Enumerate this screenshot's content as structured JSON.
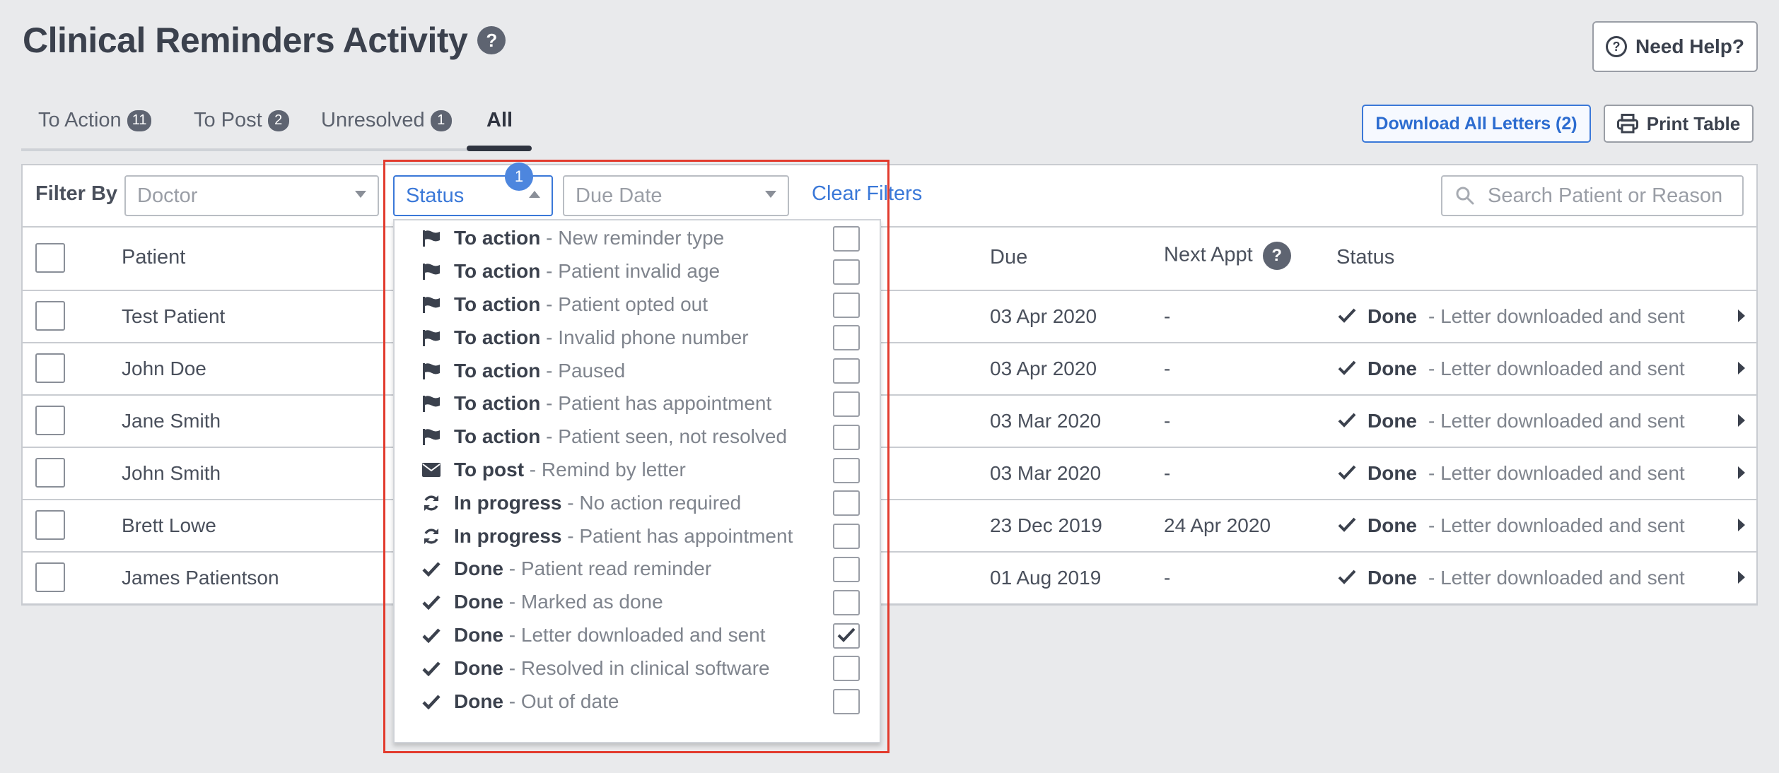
{
  "page": {
    "title": "Clinical Reminders Activity",
    "help_glyph": "?"
  },
  "need_help": {
    "label": "Need Help?"
  },
  "tabs": [
    {
      "label": "To Action",
      "count": "11"
    },
    {
      "label": "To Post",
      "count": "2"
    },
    {
      "label": "Unresolved",
      "count": "1"
    },
    {
      "label": "All",
      "count": ""
    }
  ],
  "actions": {
    "download_label": "Download All Letters (2)",
    "print_label": "Print Table"
  },
  "filters": {
    "label": "Filter By",
    "doctor_placeholder": "Doctor",
    "status_value": "Status",
    "status_count": "1",
    "due_date_placeholder": "Due Date",
    "clear_label": "Clear Filters",
    "search_placeholder": "Search Patient or Reason"
  },
  "table": {
    "headers": {
      "patient": "Patient",
      "due": "Due",
      "next_appt": "Next Appt",
      "status": "Status"
    },
    "rows": [
      {
        "patient": "Test Patient",
        "due": "03 Apr 2020",
        "next_appt": "-",
        "status": "Done",
        "status_desc": "- Letter downloaded and sent"
      },
      {
        "patient": "John Doe",
        "due": "03 Apr 2020",
        "next_appt": "-",
        "status": "Done",
        "status_desc": "- Letter downloaded and sent"
      },
      {
        "patient": "Jane Smith",
        "due": "03 Mar 2020",
        "next_appt": "-",
        "status": "Done",
        "status_desc": "- Letter downloaded and sent"
      },
      {
        "patient": "John Smith",
        "due": "03 Mar 2020",
        "next_appt": "-",
        "status": "Done",
        "status_desc": "- Letter downloaded and sent"
      },
      {
        "patient": "Brett Lowe",
        "due": "23 Dec 2019",
        "next_appt": "24 Apr 2020",
        "status": "Done",
        "status_desc": "- Letter downloaded and sent"
      },
      {
        "patient": "James Patientson",
        "due": "01 Aug 2019",
        "next_appt": "-",
        "status": "Done",
        "status_desc": "- Letter downloaded and sent"
      }
    ]
  },
  "status_options": [
    {
      "icon": "flag-icon",
      "status": "To action",
      "desc": "New reminder type",
      "checked": false
    },
    {
      "icon": "flag-icon",
      "status": "To action",
      "desc": "Patient invalid age",
      "checked": false
    },
    {
      "icon": "flag-icon",
      "status": "To action",
      "desc": "Patient opted out",
      "checked": false
    },
    {
      "icon": "flag-icon",
      "status": "To action",
      "desc": "Invalid phone number",
      "checked": false
    },
    {
      "icon": "flag-icon",
      "status": "To action",
      "desc": "Paused",
      "checked": false
    },
    {
      "icon": "flag-icon",
      "status": "To action",
      "desc": "Patient has appointment",
      "checked": false
    },
    {
      "icon": "flag-icon",
      "status": "To action",
      "desc": "Patient seen, not resolved",
      "checked": false
    },
    {
      "icon": "envelope-icon",
      "status": "To post",
      "desc": "Remind by letter",
      "checked": false
    },
    {
      "icon": "refresh-icon",
      "status": "In progress",
      "desc": "No action required",
      "checked": false
    },
    {
      "icon": "refresh-icon",
      "status": "In progress",
      "desc": "Patient has appointment",
      "checked": false
    },
    {
      "icon": "check-icon",
      "status": "Done",
      "desc": "Patient read reminder",
      "checked": false
    },
    {
      "icon": "check-icon",
      "status": "Done",
      "desc": "Marked as done",
      "checked": false
    },
    {
      "icon": "check-icon",
      "status": "Done",
      "desc": "Letter downloaded and sent",
      "checked": true
    },
    {
      "icon": "check-icon",
      "status": "Done",
      "desc": "Resolved in clinical software",
      "checked": false
    },
    {
      "icon": "check-icon",
      "status": "Done",
      "desc": "Out of date",
      "checked": false
    }
  ],
  "colors": {
    "accent": "#3a78d8",
    "highlight": "#e23b2e",
    "background": "#e9eaec",
    "badge": "#5e6471"
  }
}
